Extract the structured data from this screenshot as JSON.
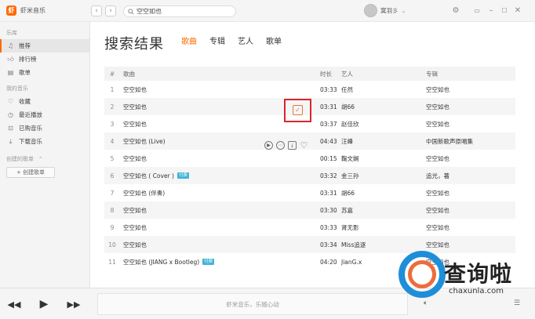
{
  "app": {
    "name": "虾米音乐",
    "logo_glyph": "虾"
  },
  "search": {
    "value": "空空如也"
  },
  "user": {
    "name": "寞羽彡"
  },
  "sidebar": {
    "sections": [
      {
        "title": "乐库",
        "items": [
          {
            "label": "推荐",
            "icon": "music-note-icon",
            "active": true
          },
          {
            "label": "排行榜",
            "icon": "thumbs-up-icon",
            "active": false
          },
          {
            "label": "歌单",
            "icon": "playlist-icon",
            "active": false
          }
        ]
      },
      {
        "title": "我的音乐",
        "items": [
          {
            "label": "收藏",
            "icon": "heart-icon",
            "active": false
          },
          {
            "label": "最近播放",
            "icon": "clock-icon",
            "active": false
          },
          {
            "label": "已购音乐",
            "icon": "cart-icon",
            "active": false
          },
          {
            "label": "下载音乐",
            "icon": "download-icon",
            "active": false
          }
        ]
      },
      {
        "title": "创建的歌单",
        "items": []
      }
    ],
    "create_button": "+ 创建歌单"
  },
  "main": {
    "title": "搜索结果",
    "tabs": [
      {
        "label": "歌曲",
        "active": true
      },
      {
        "label": "专辑",
        "active": false
      },
      {
        "label": "艺人",
        "active": false
      },
      {
        "label": "歌单",
        "active": false
      }
    ],
    "columns": {
      "index": "#",
      "song": "歌曲",
      "time": "时长",
      "artist": "艺人",
      "album": "专辑"
    },
    "rows": [
      {
        "idx": "1",
        "song": "空空如也",
        "badge": "",
        "time": "03:33",
        "artist": "任然",
        "album": "空空如也"
      },
      {
        "idx": "2",
        "song": "空空如也",
        "badge": "",
        "time": "03:31",
        "artist": "胡66",
        "album": "空空如也"
      },
      {
        "idx": "3",
        "song": "空空如也",
        "badge": "",
        "time": "03:37",
        "artist": "赵佳欣",
        "album": "空空如也"
      },
      {
        "idx": "4",
        "song": "空空如也 (Live)",
        "badge": "",
        "time": "04:43",
        "artist": "汪峰",
        "album": "中国新歌声原唱集"
      },
      {
        "idx": "5",
        "song": "空空如也",
        "badge": "",
        "time": "00:15",
        "artist": "鞠文娴",
        "album": "空空如也"
      },
      {
        "idx": "6",
        "song": "空空如也 ( Cover )",
        "badge": "付费",
        "time": "03:32",
        "artist": "金三孙",
        "album": "追光，著"
      },
      {
        "idx": "7",
        "song": "空空如也 (伴奏)",
        "badge": "",
        "time": "03:31",
        "artist": "胡66",
        "album": "空空如也"
      },
      {
        "idx": "8",
        "song": "空空如也",
        "badge": "",
        "time": "03:30",
        "artist": "苏嘉",
        "album": "空空如也"
      },
      {
        "idx": "9",
        "song": "空空如也",
        "badge": "",
        "time": "03:33",
        "artist": "肾无影",
        "album": "空空如也"
      },
      {
        "idx": "10",
        "song": "空空如也",
        "badge": "",
        "time": "03:34",
        "artist": "Miss追逐",
        "album": "空空如也"
      },
      {
        "idx": "11",
        "song": "空空如也 (JIANG x Bootleg)",
        "badge": "付费",
        "time": "04:20",
        "artist": "JianG.x",
        "album": "空空如也"
      }
    ]
  },
  "player": {
    "slogan": "虾米音乐，乐随心动"
  },
  "watermark": {
    "text": "查询啦",
    "url": "chaxunla.com"
  },
  "colors": {
    "accent": "#ff6a00",
    "highlight": "#d9262c",
    "badge": "#3fb3d6"
  }
}
